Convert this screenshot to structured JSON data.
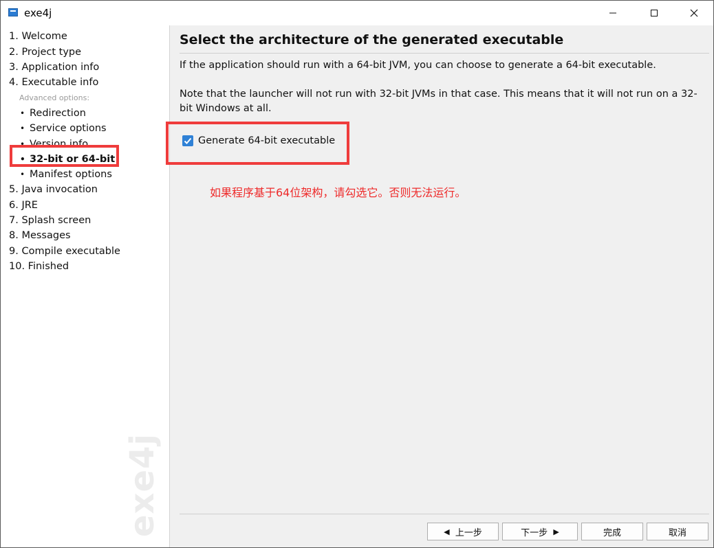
{
  "window": {
    "title": "exe4j"
  },
  "sidebar": {
    "steps": [
      {
        "label": "1. Welcome"
      },
      {
        "label": "2. Project type"
      },
      {
        "label": "3. Application info"
      },
      {
        "label": "4. Executable info"
      }
    ],
    "advanced_label": "Advanced options:",
    "sub_steps": [
      {
        "label": "Redirection"
      },
      {
        "label": "Service options"
      },
      {
        "label": "Version info"
      },
      {
        "label": "32-bit or 64-bit",
        "active": true
      },
      {
        "label": "Manifest options"
      }
    ],
    "steps_after": [
      {
        "label": "5. Java invocation"
      },
      {
        "label": "6. JRE"
      },
      {
        "label": "7. Splash screen"
      },
      {
        "label": "8. Messages"
      },
      {
        "label": "9. Compile executable"
      },
      {
        "label": "10. Finished"
      }
    ],
    "watermark": "exe4j"
  },
  "main": {
    "heading": "Select the architecture of the generated executable",
    "paragraph1": "If the application should run with a 64-bit JVM, you can choose to generate a 64-bit executable.",
    "paragraph2": "Note that the launcher will not run with 32-bit JVMs in that case. This means that it will not run on a 32-bit Windows at all.",
    "checkbox": {
      "label": "Generate 64-bit executable",
      "checked": true
    },
    "annotation_note": "如果程序基于64位架构，请勾选它。否则无法运行。"
  },
  "footer": {
    "prev_label": "上一步",
    "next_label": "下一步",
    "finish_label": "完成",
    "cancel_label": "取消"
  },
  "colors": {
    "annotation_red": "#ef3c3c",
    "checkbox_blue": "#2f81d6"
  }
}
